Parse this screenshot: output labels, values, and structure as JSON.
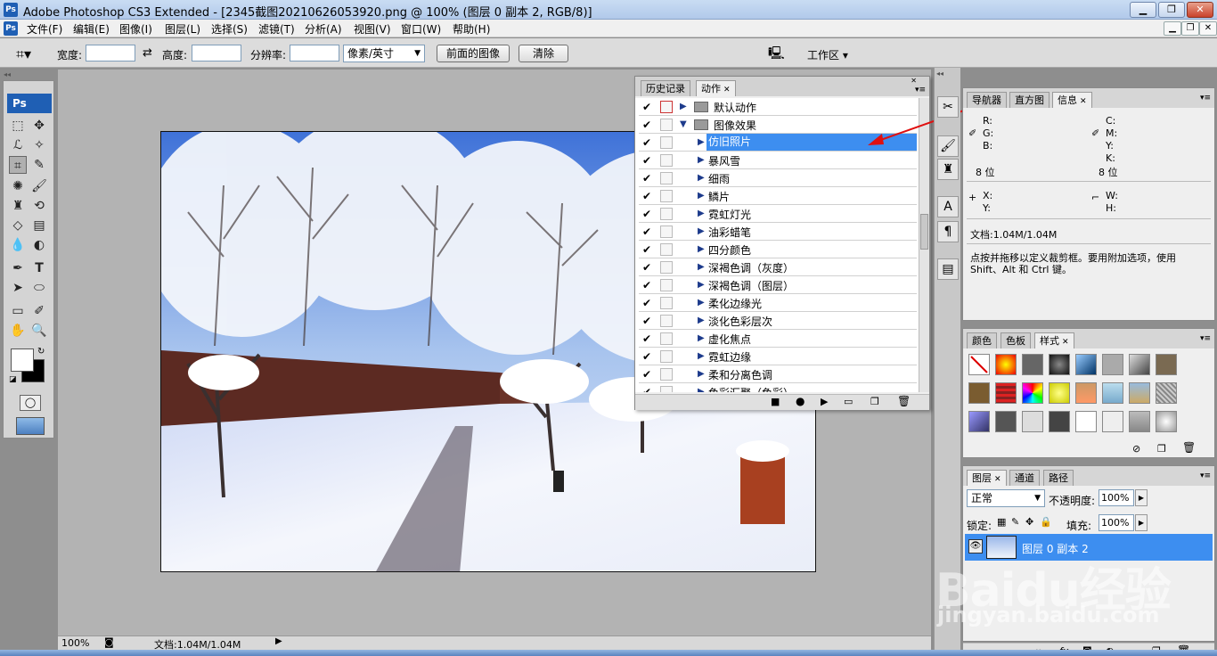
{
  "window": {
    "title": "Adobe Photoshop CS3 Extended - [2345截图20210626053920.png @ 100% (图层 0 副本 2, RGB/8)]",
    "app_badge": "Ps"
  },
  "menu": {
    "items": [
      "文件(F)",
      "编辑(E)",
      "图像(I)",
      "图层(L)",
      "选择(S)",
      "滤镜(T)",
      "分析(A)",
      "视图(V)",
      "窗口(W)",
      "帮助(H)"
    ]
  },
  "options": {
    "width_label": "宽度:",
    "height_label": "高度:",
    "resolution_label": "分辨率:",
    "unit_select": "像素/英寸",
    "front_image_button": "前面的图像",
    "clear_button": "清除",
    "workspace_label": "工作区 ▾"
  },
  "toolbox": {
    "badge": "Ps"
  },
  "status": {
    "zoom": "100%",
    "doc_info": "文档:1.04M/1.04M"
  },
  "actions_panel": {
    "tabs": [
      "历史记录",
      "动作"
    ],
    "rows": [
      {
        "label": "默认动作",
        "type": "set",
        "open": false
      },
      {
        "label": "图像效果",
        "type": "set",
        "open": true
      },
      {
        "label": "仿旧照片",
        "type": "action",
        "selected": true
      },
      {
        "label": "暴风雪",
        "type": "action"
      },
      {
        "label": "细雨",
        "type": "action"
      },
      {
        "label": "鳞片",
        "type": "action"
      },
      {
        "label": "霓虹灯光",
        "type": "action"
      },
      {
        "label": "油彩蜡笔",
        "type": "action"
      },
      {
        "label": "四分颜色",
        "type": "action"
      },
      {
        "label": "深褐色调（灰度）",
        "type": "action"
      },
      {
        "label": "深褐色调（图层）",
        "type": "action"
      },
      {
        "label": "柔化边缘光",
        "type": "action"
      },
      {
        "label": "淡化色彩层次",
        "type": "action"
      },
      {
        "label": "虚化焦点",
        "type": "action"
      },
      {
        "label": "霓虹边缘",
        "type": "action"
      },
      {
        "label": "柔和分离色调",
        "type": "action"
      },
      {
        "label": "色彩汇聚（色彩）",
        "type": "action"
      }
    ],
    "check_mark": "✔"
  },
  "info_panel": {
    "tabs": [
      "导航器",
      "直方图",
      "信息"
    ],
    "rgb_labels": [
      "R:",
      "G:",
      "B:"
    ],
    "cmyk_labels": [
      "C:",
      "M:",
      "Y:",
      "K:"
    ],
    "bit_left": "8 位",
    "bit_right": "8 位",
    "xy_labels": [
      "X:",
      "Y:"
    ],
    "wh_labels": [
      "W:",
      "H:"
    ],
    "doc": "文档:1.04M/1.04M",
    "hint": "点按并拖移以定义裁剪框。要用附加选项，使用 Shift、Alt 和 Ctrl 键。"
  },
  "styles_panel": {
    "tabs": [
      "颜色",
      "色板",
      "样式"
    ]
  },
  "layers_panel": {
    "tabs": [
      "图层",
      "通道",
      "路径"
    ],
    "blend_mode": "正常",
    "opacity_label": "不透明度:",
    "opacity_value": "100%",
    "lock_label": "锁定:",
    "fill_label": "填充:",
    "fill_value": "100%",
    "layer_name": "图层 0 副本 2"
  },
  "watermark": {
    "brand": "Baidu经验",
    "url": "jingyan.baidu.com"
  },
  "colors": {
    "selection_blue": "#3d8ef0",
    "arrow_red": "#e01010"
  }
}
